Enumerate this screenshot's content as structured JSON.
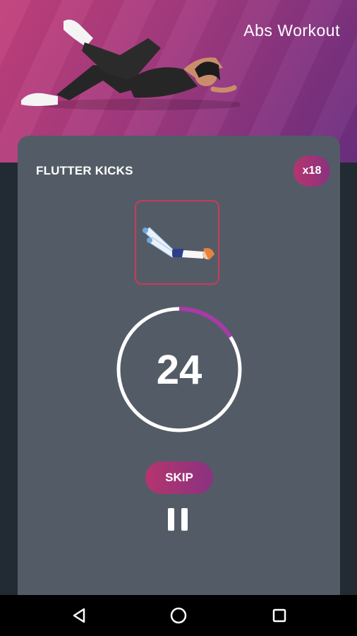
{
  "header": {
    "title": "Abs Workout"
  },
  "exercise": {
    "name": "FLUTTER KICKS",
    "reps": "x18"
  },
  "timer": {
    "value": "24",
    "progress": 0.16
  },
  "controls": {
    "skip_label": "SKIP"
  },
  "icons": {
    "pause": "pause-icon",
    "nav_back": "back-triangle-icon",
    "nav_home": "home-circle-icon",
    "nav_recents": "recents-square-icon"
  },
  "colors": {
    "accent_start": "#b5356e",
    "accent_end": "#8a3280",
    "card": "#535c66",
    "progress": "#a83aa8"
  }
}
